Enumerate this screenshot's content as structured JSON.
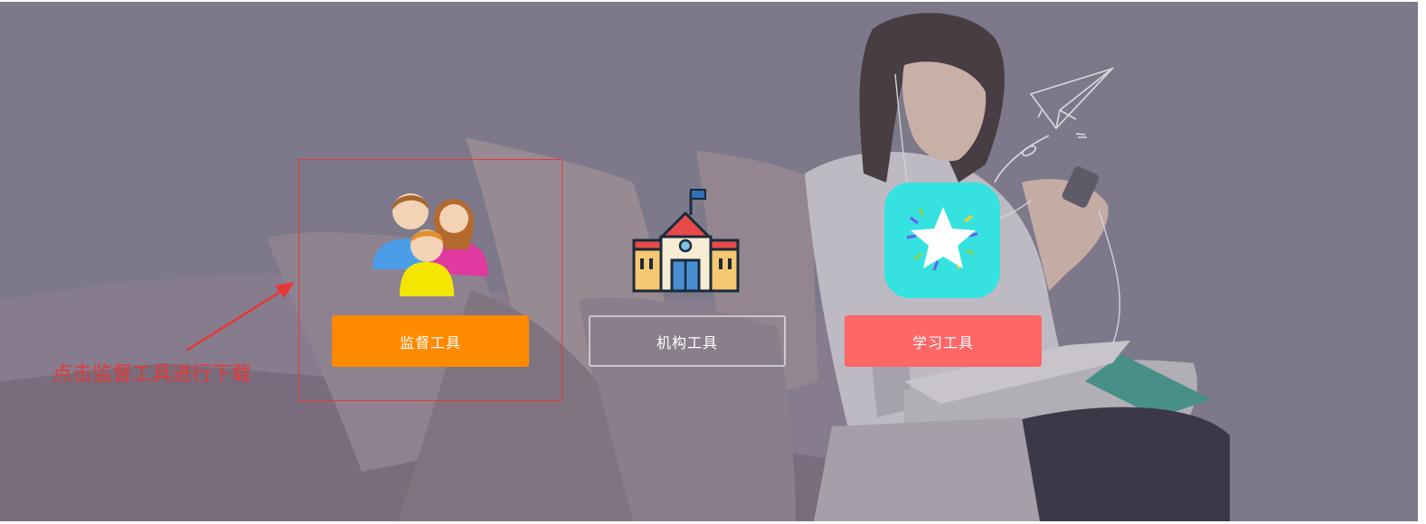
{
  "tools": [
    {
      "label": "监督工具",
      "icon": "family-icon",
      "color": "#ff8a00"
    },
    {
      "label": "机构工具",
      "icon": "school-icon",
      "color": "transparent"
    },
    {
      "label": "学习工具",
      "icon": "star-app-icon",
      "color": "#ff6666"
    }
  ],
  "annotation": {
    "text": "点击监督工具进行下载",
    "color": "#e53935"
  }
}
